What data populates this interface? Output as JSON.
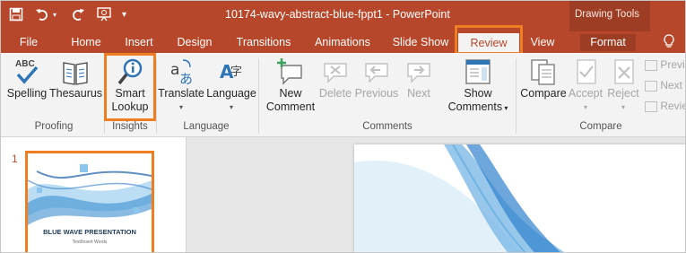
{
  "title_bar": {
    "document_title": "10174-wavy-abstract-blue-fppt1 - PowerPoint",
    "contextual_group": "Drawing Tools",
    "save_icon": "save-icon",
    "undo_icon": "undo-icon",
    "redo_icon": "redo-icon",
    "present_icon": "start-from-beginning-icon",
    "customize_icon": "customize-qat-icon"
  },
  "tabs": [
    {
      "label": "File"
    },
    {
      "label": "Home"
    },
    {
      "label": "Insert"
    },
    {
      "label": "Design"
    },
    {
      "label": "Transitions"
    },
    {
      "label": "Animations"
    },
    {
      "label": "Slide Show"
    },
    {
      "label": "Review",
      "active": true
    },
    {
      "label": "View"
    },
    {
      "label": "Format"
    }
  ],
  "tell_me_icon": "lightbulb-icon",
  "ribbon": {
    "groups": {
      "proofing": "Proofing",
      "insights": "Insights",
      "language": "Language",
      "comments": "Comments",
      "compare": "Compare"
    },
    "buttons": {
      "spelling": "Spelling",
      "thesaurus": "Thesaurus",
      "smart_lookup_line1": "Smart",
      "smart_lookup_line2": "Lookup",
      "translate": "Translate",
      "language": "Language",
      "new_comment_line1": "New",
      "new_comment_line2": "Comment",
      "delete": "Delete",
      "previous": "Previous",
      "next": "Next",
      "show_comments_line1": "Show",
      "show_comments_line2": "Comments",
      "compare": "Compare",
      "accept": "Accept",
      "reject": "Reject",
      "previous_change": "Previ",
      "next_change": "Next",
      "reviewing_pane": "Revie"
    },
    "spelling_badge": "ABC"
  },
  "slides": {
    "number": "1",
    "thumb_title": "BLUE WAVE PRESENTATION",
    "thumb_subtitle": "Text/Insert Words"
  },
  "colors": {
    "accent": "#b7472a",
    "highlight": "#ef7d22",
    "ribbon": "#f3f3f3"
  }
}
